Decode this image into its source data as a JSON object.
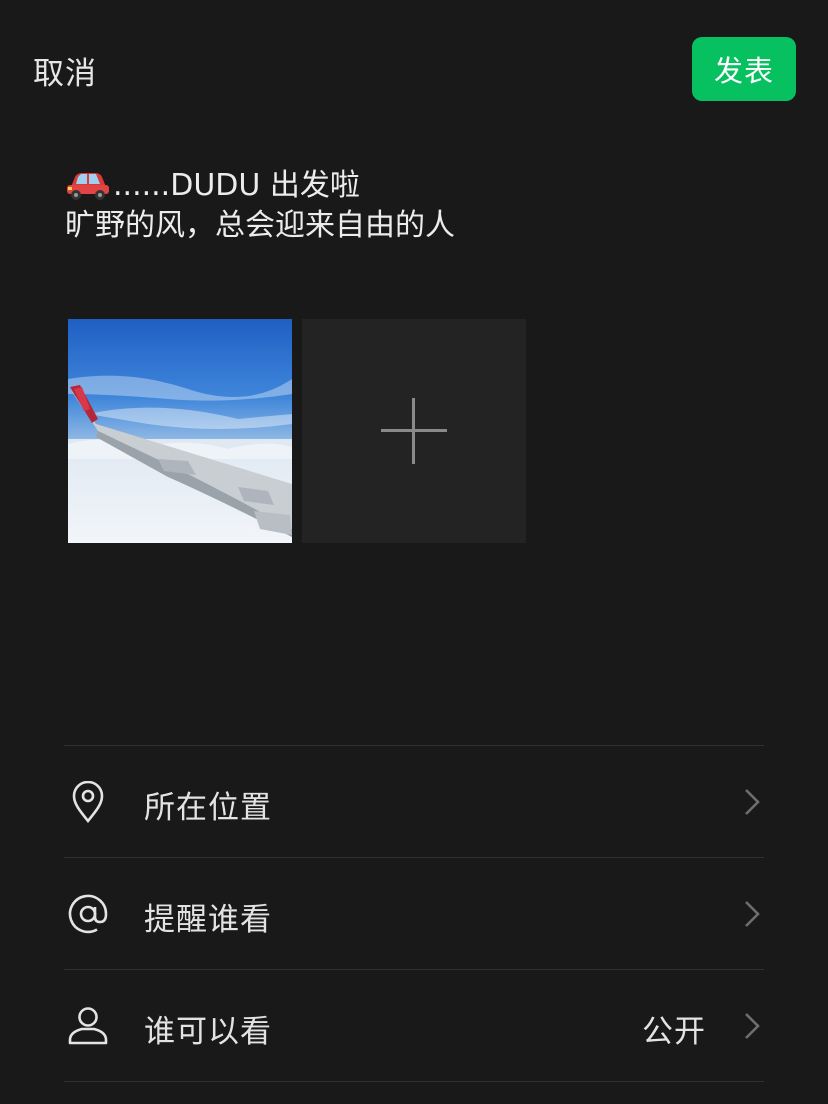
{
  "header": {
    "cancel_label": "取消",
    "publish_label": "发表",
    "accent_color": "#07c160"
  },
  "post": {
    "emoji_icon": "red-car-icon",
    "line1_text": "......DUDU 出发啦",
    "line2_text": "旷野的风，总会迎来自由的人"
  },
  "media": {
    "photos": [
      {
        "description_icon": "photo-thumbnail"
      }
    ],
    "add_icon": "plus-icon"
  },
  "menu": {
    "items": [
      {
        "icon": "location-pin-icon",
        "label": "所在位置",
        "value": ""
      },
      {
        "icon": "at-sign-icon",
        "label": "提醒谁看",
        "value": ""
      },
      {
        "icon": "person-icon",
        "label": "谁可以看",
        "value": "公开"
      }
    ]
  }
}
